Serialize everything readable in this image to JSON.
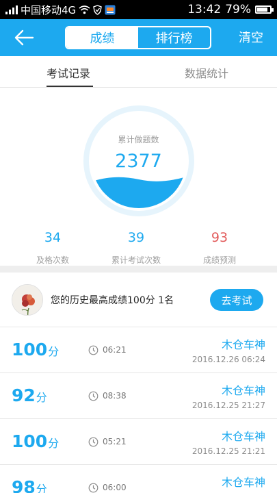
{
  "status_bar": {
    "carrier": "中国移动4G",
    "time": "13:42",
    "battery": "79%"
  },
  "header": {
    "tabs": [
      {
        "label": "成绩",
        "active": true
      },
      {
        "label": "排行榜",
        "active": false
      }
    ],
    "clear_label": "清空"
  },
  "subtabs": [
    {
      "label": "考试记录",
      "active": true
    },
    {
      "label": "数据统计",
      "active": false
    }
  ],
  "gauge": {
    "label": "累计做题数",
    "value": "2377"
  },
  "stats": [
    {
      "value": "34",
      "label": "及格次数",
      "color": "#1da9ef"
    },
    {
      "value": "39",
      "label": "累计考试次数",
      "color": "#1da9ef"
    },
    {
      "value": "93",
      "label": "成绩预测",
      "color": "#e25b5b"
    }
  ],
  "best": {
    "text": "您的历史最高成绩100分  1名",
    "button": "去考试"
  },
  "records": [
    {
      "score": "100",
      "unit": "分",
      "duration": "06:21",
      "name": "木仓车神",
      "date": "2016.12.26   06:24"
    },
    {
      "score": "92",
      "unit": "分",
      "duration": "08:38",
      "name": "木仓车神",
      "date": "2016.12.25   21:27"
    },
    {
      "score": "100",
      "unit": "分",
      "duration": "05:21",
      "name": "木仓车神",
      "date": "2016.12.25   21:21"
    },
    {
      "score": "98",
      "unit": "分",
      "duration": "06:00",
      "name": "木仓车神",
      "date": ""
    }
  ],
  "colors": {
    "accent": "#1da9ef",
    "prediction": "#e25b5b"
  }
}
